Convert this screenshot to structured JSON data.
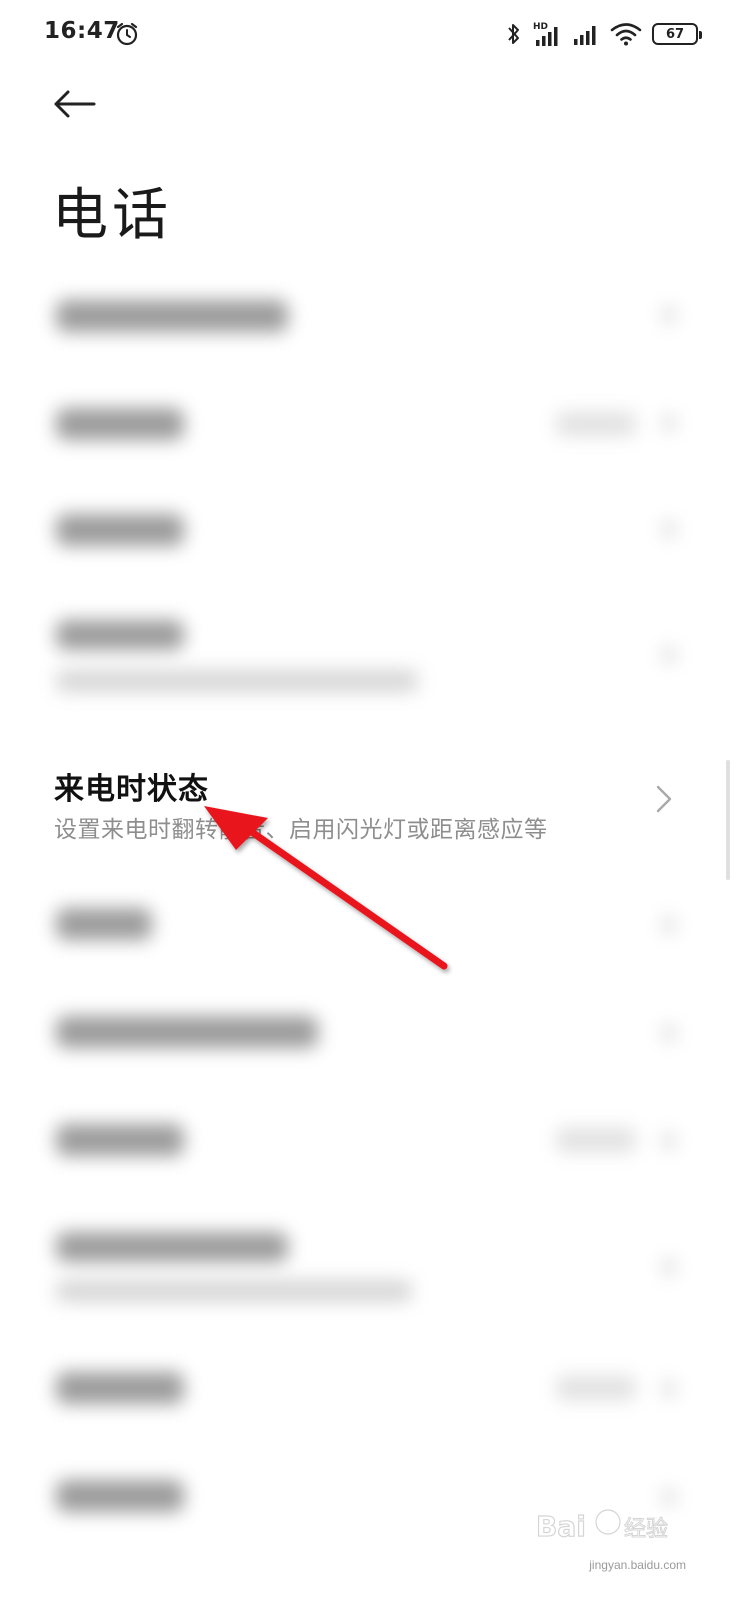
{
  "status_bar": {
    "time": "16:47",
    "battery_level": "67",
    "icons": [
      "alarm-icon",
      "bluetooth-icon",
      "hd-signal-icon",
      "signal-icon",
      "wifi-icon",
      "battery-icon"
    ]
  },
  "header": {
    "back_icon": "arrow-left-icon",
    "title": "电话"
  },
  "settings": {
    "highlighted_item": {
      "title": "来电时状态",
      "subtitle": "设置来电时翻转静音、启用闪光灯或距离感应等",
      "chevron_icon": "chevron-right-icon"
    },
    "blurred_items_count_note": ""
  },
  "annotation": {
    "arrow_color": "#e8141c"
  },
  "watermark": {
    "logo_text": "Baidu经验",
    "url": "jingyan.baidu.com"
  },
  "colors": {
    "title_text": "#111111",
    "subtitle_text": "#8e8e8e",
    "background": "#ffffff"
  }
}
